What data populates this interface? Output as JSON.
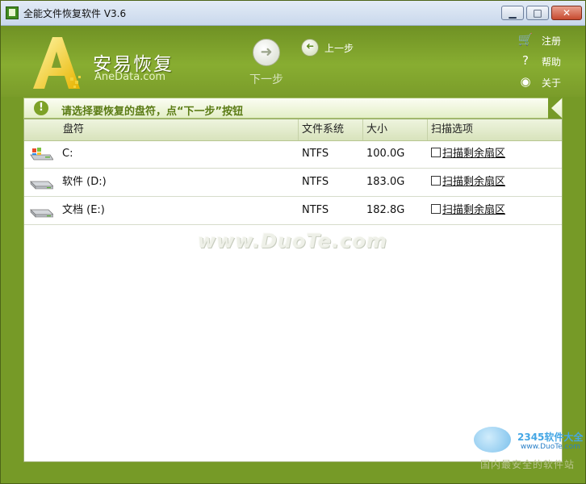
{
  "window": {
    "title": "全能文件恢复软件 V3.6",
    "controls": {
      "minimize": "▁",
      "maximize": "□",
      "close": "✕"
    }
  },
  "header": {
    "brand_name": "安易恢复",
    "brand_url": "AneData.com",
    "next_label": "下一步",
    "prev_label": "上一步",
    "menu": [
      {
        "icon": "cart-icon",
        "glyph": "🛒",
        "label": "注册"
      },
      {
        "icon": "question-icon",
        "glyph": "?",
        "label": "帮助"
      },
      {
        "icon": "info-icon",
        "glyph": "◉",
        "label": "关于"
      }
    ]
  },
  "instruction": {
    "icon": "!",
    "text": "请选择要恢复的盘符，点“下一步”按钮"
  },
  "table": {
    "columns": [
      "盘符",
      "文件系统",
      "大小",
      "扫描选项"
    ],
    "rows": [
      {
        "icon": "windows-drive-icon",
        "drive": "C:",
        "fs": "NTFS",
        "size": "100.0G",
        "scan": "扫描剩余扇区"
      },
      {
        "icon": "hard-drive-icon",
        "drive": "软件 (D:)",
        "fs": "NTFS",
        "size": "183.0G",
        "scan": "扫描剩余扇区"
      },
      {
        "icon": "hard-drive-icon",
        "drive": "文档 (E:)",
        "fs": "NTFS",
        "size": "182.8G",
        "scan": "扫描剩余扇区"
      }
    ]
  },
  "watermarks": {
    "duote": "www.DuoTe.com",
    "site_2345": "2345软件大全",
    "site_url": "www.DuoTe.com",
    "slogan": "国内最安全的软件站"
  },
  "colors": {
    "theme_green": "#769a27",
    "banner_text": "#5a7b14"
  }
}
